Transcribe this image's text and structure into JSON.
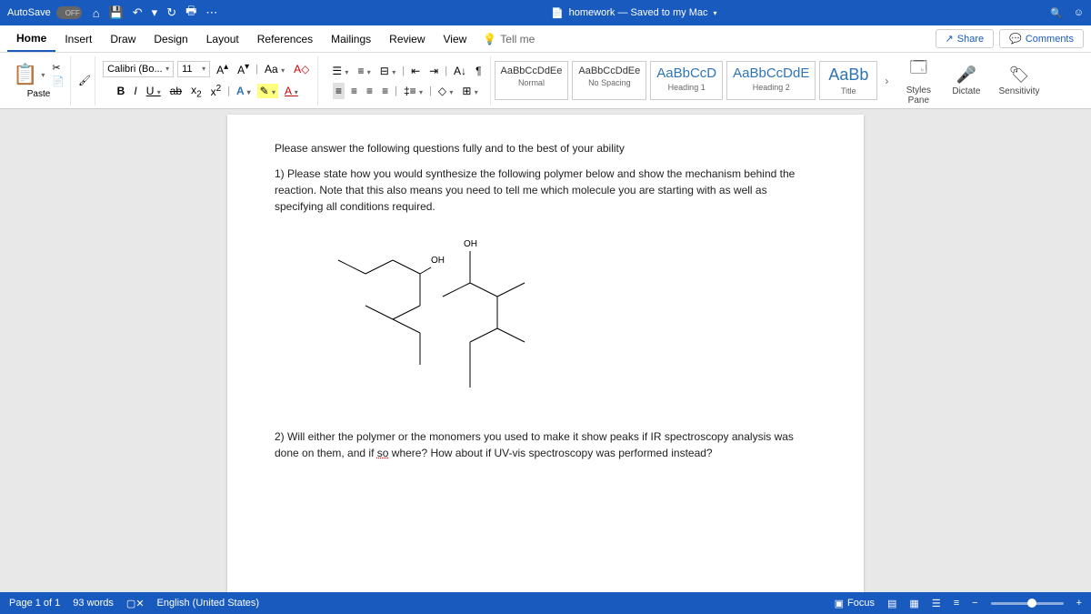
{
  "titlebar": {
    "autosave": "AutoSave",
    "toggle": "OFF",
    "doc_title": "homework — Saved to my Mac"
  },
  "tabs": {
    "home": "Home",
    "insert": "Insert",
    "draw": "Draw",
    "design": "Design",
    "layout": "Layout",
    "references": "References",
    "mailings": "Mailings",
    "review": "Review",
    "view": "View",
    "tellme": "Tell me",
    "share": "Share",
    "comments": "Comments"
  },
  "ribbon": {
    "paste": "Paste",
    "font_name": "Calibri (Bo...",
    "font_size": "11",
    "case": "Aa",
    "styles": [
      {
        "preview": "AaBbCcDdEe",
        "label": "Normal",
        "cls": ""
      },
      {
        "preview": "AaBbCcDdEe",
        "label": "No Spacing",
        "cls": ""
      },
      {
        "preview": "AaBbCcD",
        "label": "Heading 1",
        "cls": "big"
      },
      {
        "preview": "AaBbCcDdE",
        "label": "Heading 2",
        "cls": "big"
      },
      {
        "preview": "AaBb",
        "label": "Title",
        "cls": "bigger"
      }
    ],
    "styles_pane": "Styles Pane",
    "dictate": "Dictate",
    "sensitivity": "Sensitivity"
  },
  "document": {
    "intro": "Please answer the following questions fully and to the best of your ability",
    "q1": "1) Please state how you would synthesize the following polymer below and show the mechanism behind the reaction. Note that this also means you need to tell me which molecule you are starting with as well as specifying all conditions required.",
    "oh1": "OH",
    "oh2": "OH",
    "q2_a": "2) Will either the polymer or the monomers you used to make it show peaks if IR spectroscopy analysis was done on them, and if ",
    "q2_so": "so",
    "q2_b": " where? How about if UV-vis spectroscopy was performed instead?"
  },
  "status": {
    "page": "Page 1 of 1",
    "words": "93 words",
    "lang": "English (United States)",
    "focus": "Focus"
  }
}
